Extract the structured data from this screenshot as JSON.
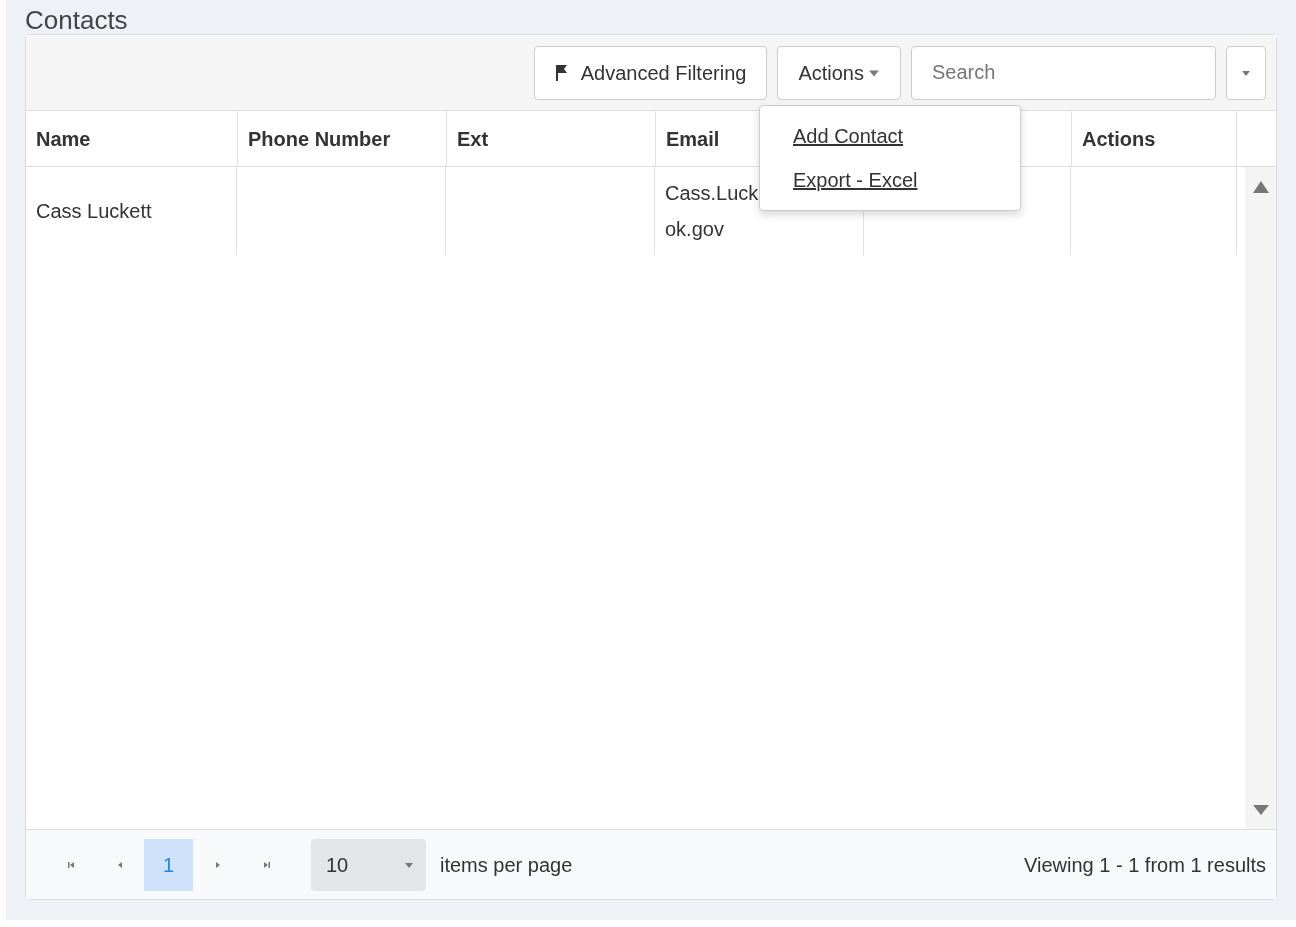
{
  "title": "Contacts",
  "toolbar": {
    "filter_button": "Advanced Filtering",
    "actions_button": "Actions",
    "search": {
      "placeholder": "Search"
    }
  },
  "actions_menu": {
    "expanded": true,
    "items": [
      "Add Contact",
      "Export - Excel"
    ]
  },
  "table": {
    "columns": [
      "Name",
      "Phone Number",
      "Ext",
      "Email",
      null,
      "Actions"
    ],
    "rows": [
      {
        "cells": [
          [
            "Cass Luckett"
          ],
          [],
          [],
          [
            "Cass.Luck",
            "ok.gov"
          ],
          [],
          []
        ]
      }
    ]
  },
  "pager": {
    "pages": [
      {
        "label": "1",
        "selected": true
      }
    ],
    "page_size": "10",
    "page_size_label": "items per page",
    "summary": "Viewing 1 - 1 from 1 results"
  }
}
